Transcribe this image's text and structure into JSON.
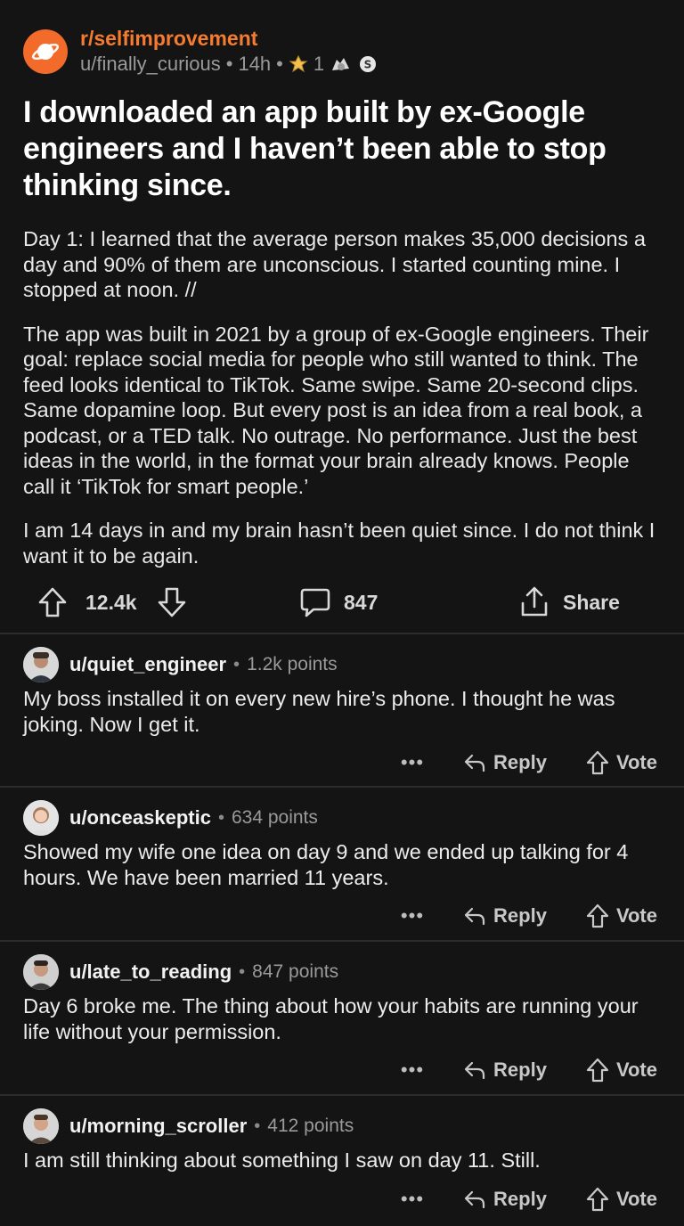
{
  "post": {
    "subreddit": "r/selfimprovement",
    "author": "u/finally_curious",
    "separator": "•",
    "age": "14h",
    "award_count": "1",
    "title": "I downloaded an app built by ex-Google engineers and I haven’t been able to stop thinking since.",
    "body": [
      "Day 1: I learned that the average person makes 35,000 decisions a day and 90% of them are unconscious. I started counting mine. I stopped at noon. //",
      "The app was built in 2021 by a group of ex-Google engineers. Their goal: replace social media for people who still wanted to think. The feed looks identical to TikTok. Same swipe. Same 20-second clips. Same dopamine loop. But every post is an idea from a real book, a podcast, or a TED talk. No outrage. No performance. Just the best ideas in the world, in the format your brain already knows. People call it ‘TikTok for smart people.’",
      "I am 14 days in and my brain hasn’t been quiet since. I do not think I want it to be again."
    ],
    "votes": "12.4k",
    "comments_count": "847",
    "share_label": "Share"
  },
  "comments": [
    {
      "user": "u/quiet_engineer",
      "points": "1.2k points",
      "text": "My boss installed it on every new hire’s phone. I thought he was joking. Now I get it.",
      "more": "•••",
      "reply_label": "Reply",
      "vote_label": "Vote"
    },
    {
      "user": "u/onceaskeptic",
      "points": "634 points",
      "text": "Showed my wife one idea on day 9 and we ended up talking for 4 hours. We have been married 11 years.",
      "more": "•••",
      "reply_label": "Reply",
      "vote_label": "Vote"
    },
    {
      "user": "u/late_to_reading",
      "points": "847 points",
      "text": "Day 6 broke me. The thing about how your habits are running your life without your permission.",
      "more": "•••",
      "reply_label": "Reply",
      "vote_label": "Vote"
    },
    {
      "user": "u/morning_scroller",
      "points": "412 points",
      "text": "I am still thinking about something I saw on day 11. Still.",
      "more": "•••",
      "reply_label": "Reply",
      "vote_label": "Vote"
    }
  ],
  "colors": {
    "background": "#141414",
    "subreddit_accent": "#f57c2e",
    "avatar_orange": "#f26b2a"
  },
  "icons": [
    "planet-icon",
    "award-icon",
    "upvote-icon",
    "downvote-icon",
    "comment-icon",
    "share-icon",
    "reply-icon",
    "more-icon"
  ]
}
